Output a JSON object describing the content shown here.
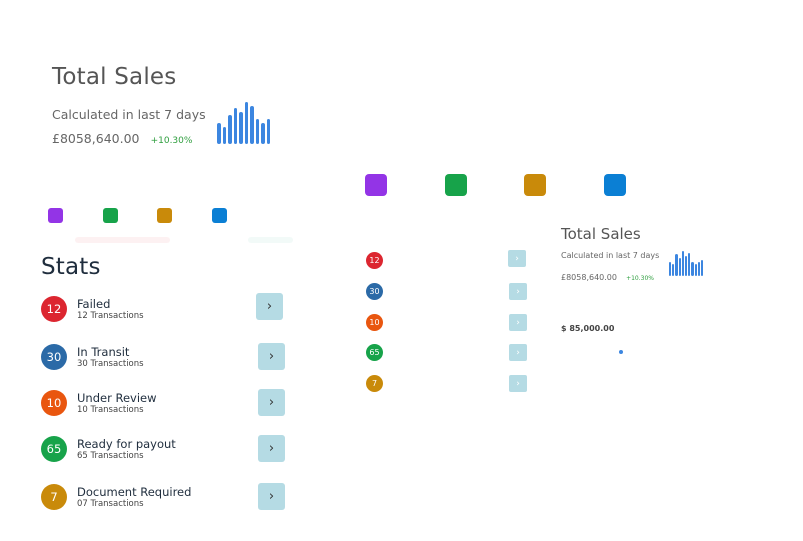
{
  "main_card": {
    "title": "Total Sales",
    "subtitle": "Calculated in last 7 days",
    "amount": "£8058,640.00",
    "change": "+10.30%",
    "bar_values": [
      0.5,
      0.4,
      0.7,
      0.85,
      0.75,
      1.0,
      0.9,
      0.6,
      0.5,
      0.6
    ]
  },
  "colors": {
    "purple": "#9334e6",
    "green": "#17a34a",
    "gold": "#c98a0a",
    "blue": "#0b7fd4",
    "red": "#dc2630",
    "navy": "#2b6aa7",
    "orange": "#e9560f",
    "accent_bar": "#3c86e0",
    "button": "#b5dbe4"
  },
  "stats": {
    "title": "Stats",
    "arrow_glyph": "›",
    "items": [
      {
        "count": "12",
        "label": "Failed",
        "sub": "12 Transactions",
        "color": "#dc2630",
        "icon": "chevron-right-icon"
      },
      {
        "count": "30",
        "label": "In Transit",
        "sub": "30 Transactions",
        "color": "#2b6aa7",
        "icon": "chevron-right-icon"
      },
      {
        "count": "10",
        "label": "Under Review",
        "sub": "10 Transactions",
        "color": "#e9560f",
        "icon": "chevron-right-icon"
      },
      {
        "count": "65",
        "label": "Ready for payout",
        "sub": "65 Transactions",
        "color": "#17a34a",
        "icon": "chevron-right-icon"
      },
      {
        "count": "7",
        "label": "Document Required",
        "sub": "07 Transactions",
        "color": "#c98a0a",
        "icon": "chevron-right-icon"
      }
    ]
  },
  "mini": {
    "counts": [
      "12",
      "30",
      "10",
      "65",
      "7"
    ],
    "arrow_glyph": "›"
  },
  "mini_card": {
    "title": "Total Sales",
    "subtitle": "Calculated in last 7 days",
    "amount": "£8058,640.00",
    "change": "+10.30%",
    "bar_values": [
      0.55,
      0.45,
      0.85,
      0.7,
      0.95,
      0.75,
      0.9,
      0.55,
      0.45,
      0.55,
      0.6
    ]
  },
  "value_label": "$ 85,000.00"
}
